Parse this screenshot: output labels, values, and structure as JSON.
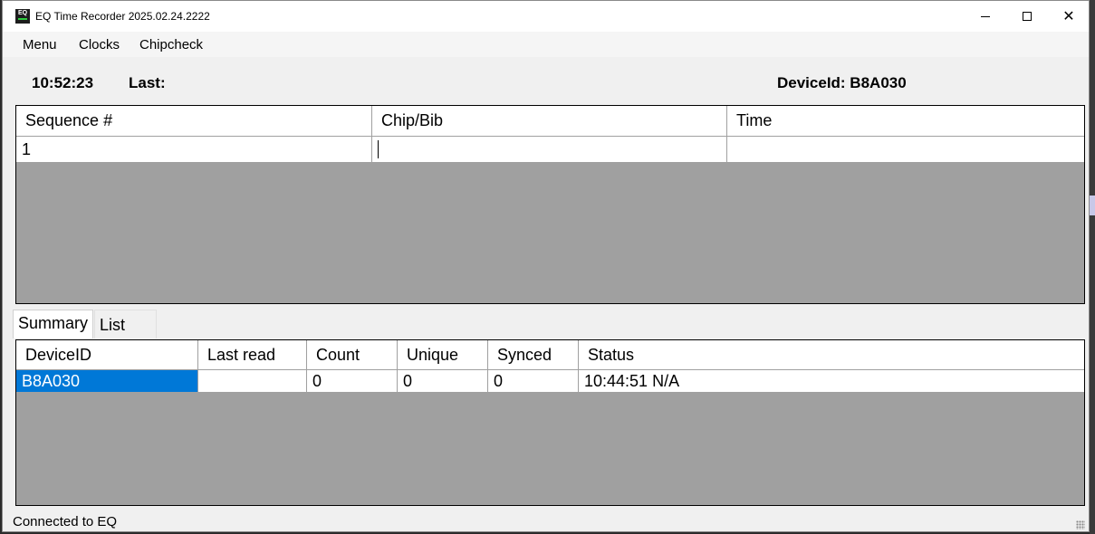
{
  "window": {
    "title": "EQ Time Recorder 2025.02.24.2222",
    "icon_text": "EQ",
    "controls": {
      "minimize": "minimize-icon",
      "maximize": "maximize-icon",
      "close": "close-icon"
    }
  },
  "menu": {
    "items": [
      "Menu",
      "Clocks",
      "Chipcheck"
    ]
  },
  "info": {
    "clock": "10:52:23",
    "last_label": "Last:",
    "device_label": "DeviceId: B8A030"
  },
  "entry_table": {
    "columns": [
      "Sequence #",
      "Chip/Bib",
      "Time"
    ],
    "rows": [
      {
        "sequence": "1",
        "chip_bib": "",
        "time": ""
      }
    ]
  },
  "tabs": [
    "Summary",
    "List"
  ],
  "active_tab": "Summary",
  "summary_table": {
    "columns": [
      "DeviceID",
      "Last read",
      "Count",
      "Unique",
      "Synced",
      "Status"
    ],
    "rows": [
      {
        "device_id": "B8A030",
        "last_read": "",
        "count": "0",
        "unique": "0",
        "synced": "0",
        "status": "10:44:51 N/A"
      }
    ]
  },
  "status": {
    "text": "Connected to EQ"
  },
  "colors": {
    "selection": "#0078d7",
    "grid_empty": "#a0a0a0",
    "icon_accent": "#2ecc40"
  }
}
